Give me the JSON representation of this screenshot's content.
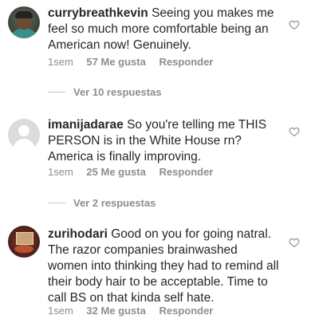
{
  "comments": [
    {
      "username": "currybreathkevin",
      "text": "Seeing you makes me feel so much more comfortable being an American now!  Genuinely.",
      "time": "1sem",
      "likes": "57 Me gusta",
      "reply_label": "Responder",
      "view_replies": "Ver 10 respuestas"
    },
    {
      "username": "imanijadarae",
      "text": "So you're telling me THIS PERSON is in the White House rn? America is finally improving.",
      "time": "1sem",
      "likes": "25 Me gusta",
      "reply_label": "Responder",
      "view_replies": "Ver 2 respuestas"
    },
    {
      "username": "zurihodari",
      "text": "Good on you for going natral. The razor companies brainwashed women into thinking they had to remind all their body hair to be acceptable. Time to call BS on that kinda self hate.",
      "time": "1sem",
      "likes": "32 Me gusta",
      "reply_label": "Responder"
    }
  ],
  "icons": {
    "like": "heart-outline-icon"
  }
}
